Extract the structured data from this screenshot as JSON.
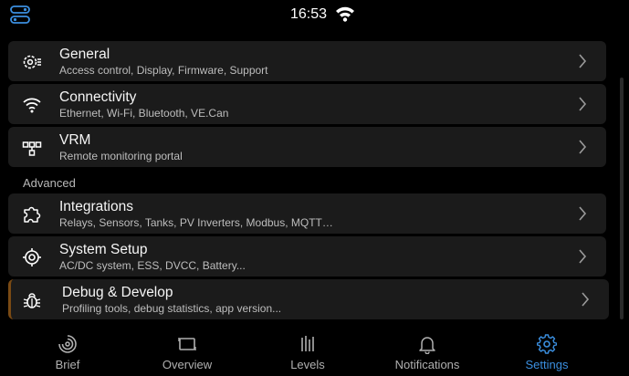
{
  "status_bar": {
    "time": "16:53",
    "menu_icon": "toggle-menu-icon",
    "wifi_icon": "wifi-icon"
  },
  "menu": {
    "items": [
      {
        "title": "General",
        "subtitle": "Access control, Display, Firmware, Support",
        "icon": "gear-icon"
      },
      {
        "title": "Connectivity",
        "subtitle": "Ethernet, Wi-Fi, Bluetooth, VE.Can",
        "icon": "wifi-icon"
      },
      {
        "title": "VRM",
        "subtitle": "Remote monitoring portal",
        "icon": "network-icon"
      }
    ],
    "advanced_label": "Advanced",
    "advanced_items": [
      {
        "title": "Integrations",
        "subtitle": "Relays, Sensors, Tanks, PV Inverters, Modbus, MQTT…",
        "icon": "puzzle-icon"
      },
      {
        "title": "System Setup",
        "subtitle": "AC/DC system, ESS, DVCC, Battery...",
        "icon": "crosshair-icon"
      },
      {
        "title": "Debug & Develop",
        "subtitle": "Profiling tools, debug statistics, app version...",
        "icon": "bug-icon"
      }
    ]
  },
  "nav": {
    "items": [
      {
        "label": "Brief",
        "icon": "brief-icon"
      },
      {
        "label": "Overview",
        "icon": "overview-icon"
      },
      {
        "label": "Levels",
        "icon": "levels-icon"
      },
      {
        "label": "Notifications",
        "icon": "bell-icon"
      },
      {
        "label": "Settings",
        "icon": "settings-icon"
      }
    ],
    "active": "Settings"
  },
  "colors": {
    "background": "#000000",
    "card": "#1b1b1b",
    "accent": "#3b8fe0",
    "highlight_bar": "#7a4a14"
  }
}
